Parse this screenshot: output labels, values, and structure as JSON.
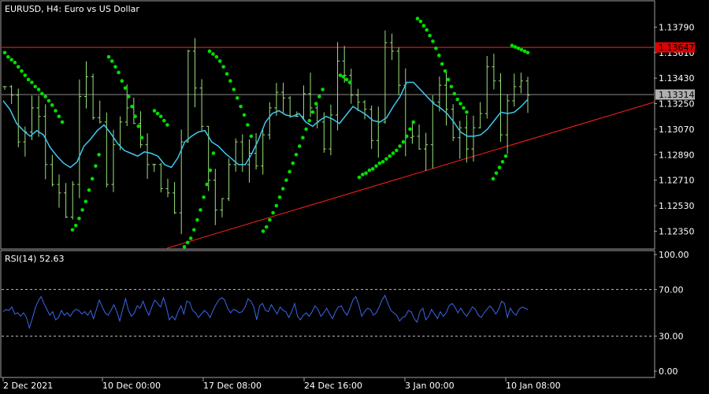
{
  "header": {
    "title": "EURUSD, H4:  Euro vs US Dollar"
  },
  "rsi_panel": {
    "title": "RSI(14) 52.63"
  },
  "colors": {
    "background": "#000000",
    "candles": "#9be07c",
    "ma_line": "#40c8f0",
    "sar_dots": "#00e000",
    "resistance_line": "#ff2020",
    "trendline": "#ff2020",
    "current_price_line": "#8a8a8a",
    "rsi_line": "#3a66e8",
    "rsi_level": "#c0c0c0",
    "resistance_tag": "#e00000",
    "price_tag": "#b0b0b0"
  },
  "chart_data": [
    {
      "type": "candlestick",
      "symbol": "EURUSD",
      "timeframe": "H4",
      "description": "Euro vs US Dollar",
      "price_ticks": [
        "1.13790",
        "1.13610",
        "1.13430",
        "1.13250",
        "1.13070",
        "1.12890",
        "1.12710",
        "1.12530",
        "1.12350"
      ],
      "ylim": [
        1.1223,
        1.1397
      ],
      "x_ticks": [
        "2 Dec 2021",
        "10 Dec 00:00",
        "17 Dec 08:00",
        "24 Dec 16:00",
        "3 Jan 00:00",
        "10 Jan 08:00"
      ],
      "resistance_level": "1.13647",
      "current_price": "1.13314",
      "trendline": {
        "start": 1.1223,
        "end": 1.1326
      },
      "ma_values": [
        1.1327,
        1.1321,
        1.1311,
        1.1306,
        1.1302,
        1.1306,
        1.1303,
        1.1294,
        1.1288,
        1.1283,
        1.128,
        1.1284,
        1.1295,
        1.13,
        1.1306,
        1.131,
        1.1304,
        1.1297,
        1.1292,
        1.129,
        1.1288,
        1.1291,
        1.129,
        1.1288,
        1.1282,
        1.128,
        1.1287,
        1.1298,
        1.1302,
        1.1305,
        1.1306,
        1.1298,
        1.1295,
        1.129,
        1.1286,
        1.1282,
        1.1282,
        1.129,
        1.13,
        1.1312,
        1.1318,
        1.132,
        1.1317,
        1.1316,
        1.1318,
        1.1312,
        1.1309,
        1.1313,
        1.1316,
        1.1314,
        1.1311,
        1.1317,
        1.1323,
        1.132,
        1.1317,
        1.1313,
        1.1312,
        1.1315,
        1.1323,
        1.133,
        1.134,
        1.134,
        1.1335,
        1.133,
        1.1325,
        1.1322,
        1.1318,
        1.1312,
        1.1305,
        1.1302,
        1.1302,
        1.1303,
        1.1307,
        1.1313,
        1.1319,
        1.1318,
        1.1319,
        1.1323,
        1.1328
      ],
      "candle_closes": [
        1.1337,
        1.1331,
        1.1298,
        1.1305,
        1.1322,
        1.1316,
        1.1282,
        1.1268,
        1.1262,
        1.1245,
        1.1268,
        1.133,
        1.1344,
        1.1315,
        1.1312,
        1.1268,
        1.1296,
        1.1312,
        1.1322,
        1.1311,
        1.1296,
        1.1282,
        1.1282,
        1.1265,
        1.1262,
        1.1248,
        1.1298,
        1.1362,
        1.1336,
        1.1309,
        1.1271,
        1.125,
        1.1258,
        1.1282,
        1.1298,
        1.1282,
        1.129,
        1.1281,
        1.1303,
        1.1322,
        1.1333,
        1.1329,
        1.1316,
        1.1316,
        1.1332,
        1.1322,
        1.1312,
        1.1293,
        1.1317,
        1.1355,
        1.1345,
        1.1331,
        1.1326,
        1.1321,
        1.1299,
        1.1312,
        1.1368,
        1.1362,
        1.1338,
        1.1301,
        1.1302,
        1.1293,
        1.1296,
        1.1326,
        1.1338,
        1.1321,
        1.1301,
        1.1308,
        1.1293,
        1.1308,
        1.1318,
        1.1351,
        1.1341,
        1.1303,
        1.1327,
        1.1337,
        1.1341,
        1.1331
      ],
      "sar_segments": [
        [
          [
            1.1361,
            1.1358,
            1.1356,
            1.1354,
            1.1351,
            1.1348,
            1.1345,
            1.1342,
            1.134,
            1.1337,
            1.1335,
            1.1332,
            1.133,
            1.1327,
            1.1324,
            1.132,
            1.1316,
            1.1312
          ]
        ],
        [
          [
            1.1236,
            1.1239,
            1.1244,
            1.125,
            1.1256,
            1.1264,
            1.1272,
            1.1281,
            1.1289
          ]
        ],
        [
          [
            1.1358,
            1.1355,
            1.1351,
            1.1347,
            1.1341,
            1.1336,
            1.133,
            1.1323,
            1.1316,
            1.1309,
            1.1301
          ]
        ],
        [
          [
            1.132,
            1.1318,
            1.1316,
            1.1313,
            1.131
          ]
        ],
        [
          [
            1.1224,
            1.1227,
            1.123,
            1.1236,
            1.1243,
            1.125,
            1.1259,
            1.1268,
            1.1278,
            1.129
          ]
        ],
        [
          [
            1.1362,
            1.136,
            1.1358,
            1.1355,
            1.1351,
            1.1346,
            1.1341,
            1.1335,
            1.1329,
            1.1323,
            1.1317,
            1.131,
            1.1302
          ]
        ],
        [
          [
            1.1235,
            1.1238,
            1.1243,
            1.1248,
            1.1253,
            1.1259,
            1.1265,
            1.1271,
            1.1277,
            1.1283,
            1.1289,
            1.1295,
            1.1301,
            1.1307,
            1.1313,
            1.1319,
            1.1325,
            1.133,
            1.1335
          ]
        ],
        [
          [
            1.1345,
            1.1344,
            1.1342,
            1.134
          ]
        ],
        [
          [
            1.1273,
            1.1275,
            1.1276,
            1.1278,
            1.1279,
            1.1281,
            1.1283,
            1.1284,
            1.1286,
            1.1288,
            1.129,
            1.1292,
            1.1295,
            1.1298,
            1.1302,
            1.1307,
            1.1312
          ]
        ],
        [
          [
            1.1385,
            1.1383,
            1.138,
            1.1377,
            1.1373,
            1.1369,
            1.1364,
            1.1359,
            1.1353,
            1.1348,
            1.1342,
            1.1337,
            1.1332,
            1.1328,
            1.1325,
            1.1322,
            1.1319
          ]
        ],
        [
          [
            1.1272,
            1.1276,
            1.128,
            1.1284,
            1.1288
          ]
        ],
        [
          [
            1.1366,
            1.1365,
            1.1364,
            1.1363,
            1.1362,
            1.1361
          ]
        ]
      ]
    },
    {
      "type": "line",
      "title": "RSI(14) 52.63",
      "y_ticks": [
        "100.00",
        "70.00",
        "30.00",
        "0.00"
      ],
      "ylim": [
        0,
        100
      ],
      "levels": [
        70,
        30
      ],
      "values": [
        51,
        53,
        52,
        55,
        49,
        50,
        47,
        50,
        46,
        37,
        45,
        54,
        60,
        64,
        58,
        53,
        48,
        51,
        44,
        46,
        52,
        48,
        50,
        47,
        51,
        53,
        52,
        49,
        51,
        48,
        52,
        45,
        53,
        61,
        55,
        50,
        48,
        52,
        57,
        51,
        43,
        53,
        62,
        52,
        47,
        50,
        56,
        54,
        60,
        53,
        48,
        55,
        61,
        58,
        55,
        63,
        55,
        44,
        47,
        44,
        51,
        56,
        49,
        60,
        59,
        52,
        50,
        46,
        49,
        52,
        50,
        46,
        52,
        57,
        61,
        63,
        61,
        54,
        50,
        53,
        52,
        50,
        51,
        55,
        62,
        60,
        55,
        44,
        56,
        58,
        52,
        51,
        57,
        53,
        49,
        55,
        52,
        51,
        46,
        51,
        58,
        47,
        44,
        48,
        50,
        47,
        51,
        56,
        53,
        47,
        50,
        54,
        49,
        45,
        51,
        55,
        56,
        51,
        48,
        54,
        61,
        64,
        57,
        47,
        51,
        54,
        53,
        48,
        50,
        55,
        61,
        65,
        58,
        52,
        50,
        48,
        43,
        46,
        47,
        52,
        51,
        45,
        42,
        51,
        54,
        44,
        47,
        53,
        49,
        45,
        51,
        47,
        50,
        56,
        58,
        55,
        50,
        54,
        50,
        47,
        51,
        55,
        53,
        48,
        46,
        50,
        53,
        56,
        53,
        49,
        53,
        60,
        58,
        46,
        54,
        50,
        48,
        53,
        55,
        54,
        53
      ]
    }
  ]
}
